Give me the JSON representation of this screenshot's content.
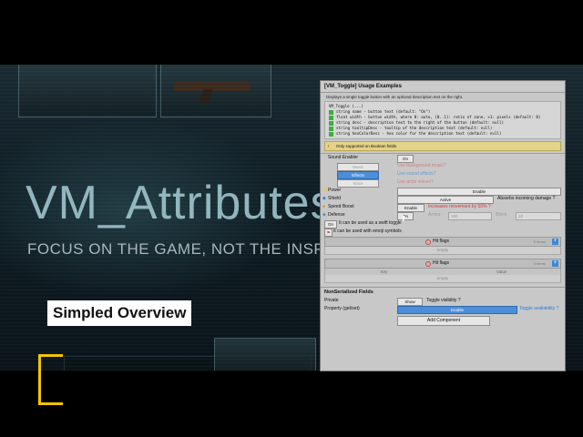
{
  "video": {
    "title": "VM_Attributes",
    "tagline": "FOCUS ON THE GAME, NOT THE INSPECTOR",
    "overlay_label": "Simpled Overview"
  },
  "inspector": {
    "header": "[VM_Toggle] Usage Examples",
    "description": "Displays a single toggle button with an optional description text on the right.",
    "code_title": "VM_Toggle (...)",
    "code_lines": [
      "string name - button text (default: \"On\")",
      "float width - button width, where 0: auto, (0..1): ratio of zone, >1: pixels (default: 0)",
      "string desc - description text to the right of the button (default: null)",
      "string tooltipDesc - tooltip of the description text (default: null)",
      "string hexColorDesc - hex color for the description text (default: null)"
    ],
    "warning": "Only supported on Boolean fields",
    "sound_enabler": {
      "label": "Sound Enabler",
      "button": "On"
    },
    "music": {
      "label": "Music",
      "desc": "Use background music?"
    },
    "effects": {
      "label": "Effects",
      "desc": "Use sound effects?"
    },
    "voice": {
      "label": "Voice",
      "desc": "Use actor voices?"
    },
    "power": {
      "label": "Power",
      "button": "Enable"
    },
    "shield": {
      "label": "Shield",
      "button": "Active",
      "desc": "Absorbs incoming damage ?"
    },
    "speed_boost": {
      "label": "Speed Boost",
      "button": "Enable",
      "desc": "Increases movement by 50% ?"
    },
    "defense": {
      "label": "Defense",
      "button": "On",
      "armor_label": "Armor",
      "armor_value": "100",
      "block_label": "Block",
      "block_value": "10"
    },
    "swift": {
      "button": "On",
      "desc": "It can be used as a swift toggle"
    },
    "emoji": {
      "desc": "It can be used with emoji symbols"
    },
    "hit_flags_1": {
      "title": "Hit flags",
      "count": "0 Items",
      "empty": "empty"
    },
    "cols": [
      "Key",
      "Value"
    ],
    "hit_flags_2": {
      "title": "Hit flags",
      "count": "0 Items",
      "empty": "empty"
    },
    "nonserialized_header": "NonSerialized Fields",
    "private": {
      "label": "Private",
      "button": "Show",
      "desc": "Toggle visibility ?"
    },
    "property": {
      "label": "Property (get/set)",
      "button": "Enable",
      "desc": "Toggle availability ?"
    },
    "add_component": "Add Component"
  },
  "colors": {
    "accent_yellow": "#f2c500",
    "title_cyan": "#9fc5cc",
    "toggle_blue": "#4d8ed8",
    "desc_red": "#d23a3a",
    "desc_blue": "#2f7ad8"
  }
}
